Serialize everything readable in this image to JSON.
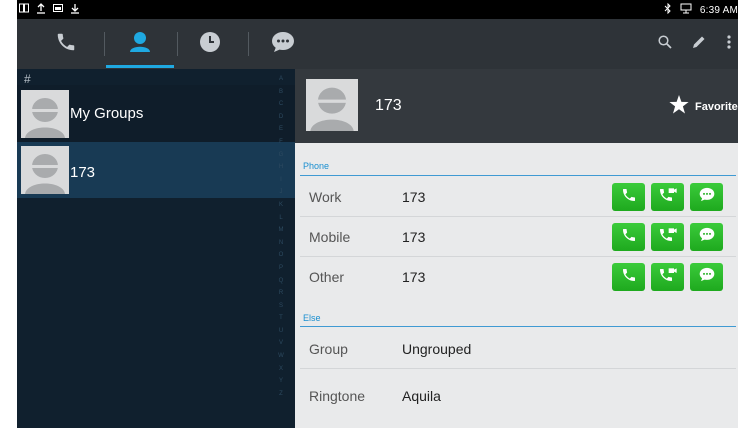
{
  "status_bar": {
    "left_icons": [
      "usb-debug-icon",
      "upload-icon",
      "screenshot-icon",
      "download-icon"
    ],
    "right_icons": [
      "bluetooth-icon",
      "usb-icon"
    ],
    "time": "6:39 AM"
  },
  "tabs": [
    {
      "name": "dialer",
      "icon": "phone-icon",
      "active": false
    },
    {
      "name": "contacts",
      "icon": "person-icon",
      "active": true
    },
    {
      "name": "history",
      "icon": "clock-icon",
      "active": false
    },
    {
      "name": "messages",
      "icon": "chat-icon",
      "active": false
    }
  ],
  "actions": {
    "search_icon": "search-icon",
    "edit_icon": "edit-icon",
    "menu_icon": "more-icon"
  },
  "contacts_list": {
    "index_header": "#",
    "items": [
      {
        "label": "My Groups"
      },
      {
        "label": "173"
      }
    ],
    "alphabet": [
      "A",
      "B",
      "C",
      "D",
      "E",
      "F",
      "G",
      "H",
      "I",
      "J",
      "K",
      "L",
      "M",
      "N",
      "O",
      "P",
      "Q",
      "R",
      "S",
      "T",
      "U",
      "V",
      "W",
      "X",
      "Y",
      "Z"
    ]
  },
  "detail": {
    "name": "173",
    "favorite_label": "Favorite",
    "phone_section": "Phone",
    "else_section": "Else",
    "phones": [
      {
        "label": "Work",
        "value": "173"
      },
      {
        "label": "Mobile",
        "value": "173"
      },
      {
        "label": "Other",
        "value": "173"
      }
    ],
    "group": {
      "label": "Group",
      "value": "Ungrouped"
    },
    "ringtone": {
      "label": "Ringtone",
      "value": "Aquila"
    }
  },
  "colors": {
    "accent": "#1fa9e1",
    "call_green": "#2cbd2c",
    "tab_bar": "#2e3338",
    "list_bg": "#10202e",
    "selected_row": "#183a54"
  }
}
